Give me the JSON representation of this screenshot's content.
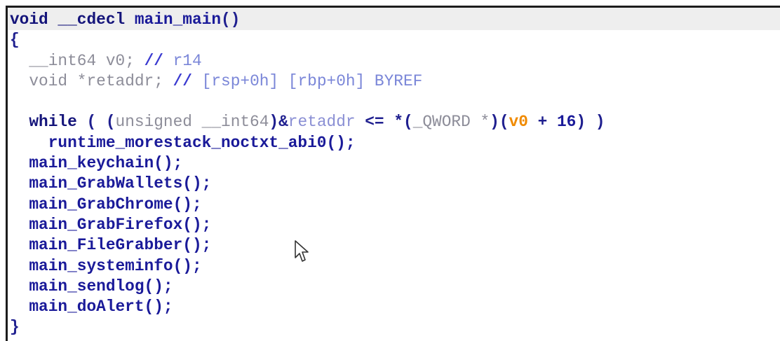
{
  "code_view": {
    "line_1": {
      "ret_type": "void",
      "callconv": "__cdecl",
      "func_name": "main_main",
      "parens": "()"
    },
    "line_2": {
      "brace": "{"
    },
    "line_3": {
      "type": "__int64",
      "var": "v0;",
      "comment_marker": "//",
      "comment_text": "r14"
    },
    "line_4": {
      "type": "void",
      "var": "*retaddr;",
      "comment_marker": "//",
      "comment_text": "[rsp+0h] [rbp+0h] BYREF"
    },
    "line_5": {
      "keyword": "while",
      "open": "(",
      "cast_open": "(",
      "cast_type": "unsigned __int64",
      "cast_close": ")&",
      "lhs_var": "retaddr",
      "op": "<=",
      "deref": "*(",
      "qword_type": "_QWORD *",
      "paren_close": ")(",
      "rhs_var": "v0",
      "plus": "+",
      "offset": "16",
      "close": ") )"
    },
    "line_6": {
      "call": "runtime_morestack_noctxt_abi0();"
    },
    "calls": [
      "main_keychain();",
      "main_GrabWallets();",
      "main_GrabChrome();",
      "main_GrabFirefox();",
      "main_FileGrabber();",
      "main_systeminfo();",
      "main_sendlog();",
      "main_doAlert();"
    ],
    "closing_brace": "}"
  },
  "colors": {
    "code_default": "#1f1f8f",
    "dim_type": "#8d8d99",
    "comment": "#7a86d8",
    "highlight_var": "#f08a00",
    "header_band": "#eeeeee",
    "border": "#1c1c1c"
  },
  "icons": {
    "mouse_pointer": "arrow-cursor-icon"
  }
}
